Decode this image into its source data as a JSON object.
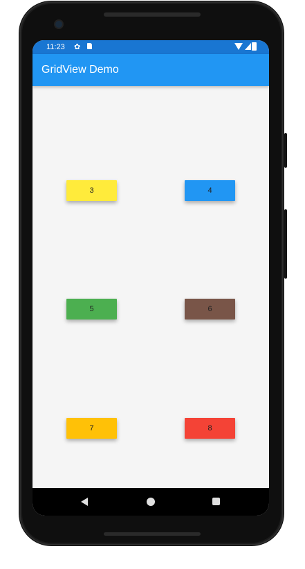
{
  "status_bar": {
    "time": "11:23"
  },
  "app_bar": {
    "title": "GridView Demo"
  },
  "grid": {
    "items": [
      {
        "label": "3",
        "color": "#ffeb3b"
      },
      {
        "label": "4",
        "color": "#2196f3"
      },
      {
        "label": "5",
        "color": "#4caf50"
      },
      {
        "label": "6",
        "color": "#795548"
      },
      {
        "label": "7",
        "color": "#ffc107"
      },
      {
        "label": "8",
        "color": "#f44336"
      }
    ]
  },
  "icons": {
    "status": [
      "gear-icon",
      "sd-card-icon",
      "wifi-icon",
      "signal-icon",
      "battery-icon"
    ],
    "navigation": [
      "back-icon",
      "home-icon",
      "recents-icon"
    ]
  }
}
